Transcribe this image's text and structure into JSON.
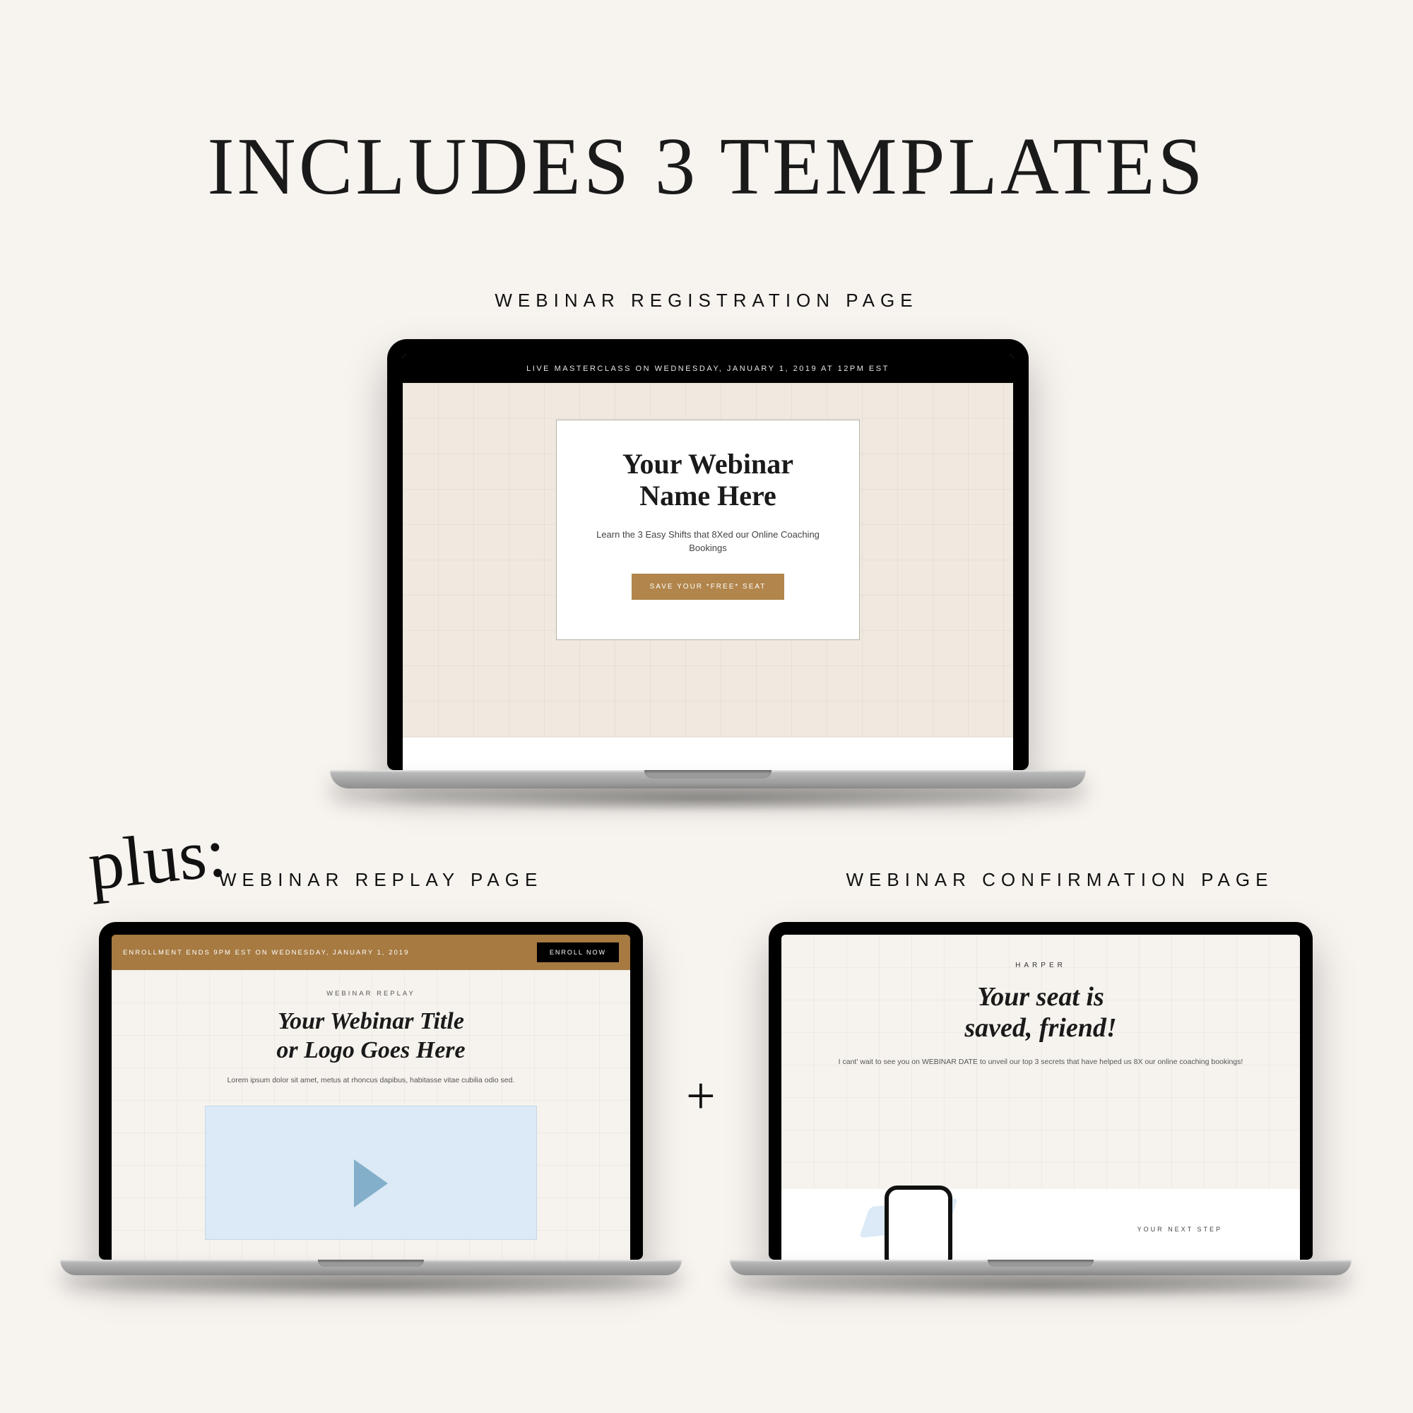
{
  "headline": "INCLUDES 3 TEMPLATES",
  "labels": {
    "top": "WEBINAR REGISTRATION PAGE",
    "left": "WEBINAR REPLAY PAGE",
    "right": "WEBINAR CONFIRMATION PAGE"
  },
  "script_word": "plus:",
  "plus_symbol": "+",
  "registration": {
    "banner": "LIVE MASTERCLASS ON WEDNESDAY, JANUARY 1, 2019 AT 12PM EST",
    "title_line1": "Your Webinar",
    "title_line2": "Name Here",
    "subtitle": "Learn the 3 Easy Shifts that 8Xed our Online Coaching Bookings",
    "button": "SAVE YOUR *FREE* SEAT"
  },
  "replay": {
    "banner": "ENROLLMENT ENDS 9PM EST ON WEDNESDAY, JANUARY 1, 2019",
    "cta": "ENROLL NOW",
    "eyebrow": "WEBINAR REPLAY",
    "title_line1": "Your Webinar Title",
    "title_line2": "or Logo Goes Here",
    "subtitle": "Lorem ipsum dolor sit amet, metus at rhoncus dapibus, habitasse vitae cubilia odio sed."
  },
  "confirmation": {
    "eyebrow": "HARPER",
    "title_line1": "Your seat is",
    "title_line2": "saved, friend!",
    "subtitle": "I cant' wait to see you on WEBINAR DATE to unveil our top 3 secrets that have helped us 8X our online coaching bookings!",
    "next": "YOUR NEXT STEP"
  }
}
